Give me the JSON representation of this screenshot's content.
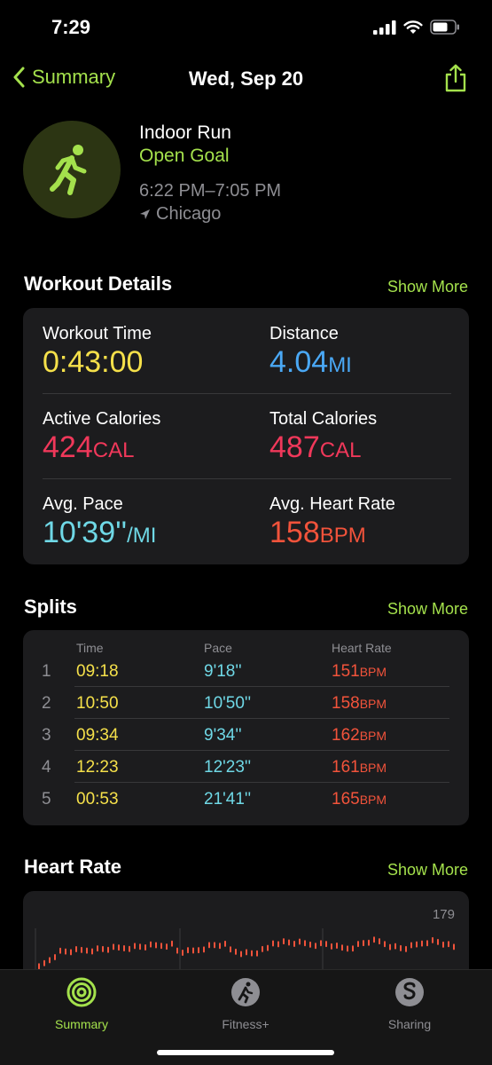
{
  "status_bar": {
    "time": "7:29"
  },
  "nav": {
    "back_label": "Summary",
    "title": "Wed, Sep 20"
  },
  "workout": {
    "type": "Indoor Run",
    "goal": "Open Goal",
    "time_range": "6:22 PM–7:05 PM",
    "location": "Chicago"
  },
  "details": {
    "title": "Workout Details",
    "show_more": "Show More",
    "workout_time": {
      "label": "Workout Time",
      "value": "0:43:00",
      "unit": ""
    },
    "distance": {
      "label": "Distance",
      "value": "4.04",
      "unit": "MI"
    },
    "active_calories": {
      "label": "Active Calories",
      "value": "424",
      "unit": "CAL"
    },
    "total_calories": {
      "label": "Total Calories",
      "value": "487",
      "unit": "CAL"
    },
    "avg_pace": {
      "label": "Avg. Pace",
      "value": "10'39''",
      "unit": "/MI"
    },
    "avg_heart_rate": {
      "label": "Avg. Heart Rate",
      "value": "158",
      "unit": "BPM"
    }
  },
  "splits": {
    "title": "Splits",
    "show_more": "Show More",
    "headers": {
      "time": "Time",
      "pace": "Pace",
      "hr": "Heart Rate"
    },
    "rows": [
      {
        "num": "1",
        "time": "09:18",
        "pace": "9'18''",
        "hr": "151",
        "unit": "BPM"
      },
      {
        "num": "2",
        "time": "10:50",
        "pace": "10'50''",
        "hr": "158",
        "unit": "BPM"
      },
      {
        "num": "3",
        "time": "09:34",
        "pace": "9'34''",
        "hr": "162",
        "unit": "BPM"
      },
      {
        "num": "4",
        "time": "12:23",
        "pace": "12'23''",
        "hr": "161",
        "unit": "BPM"
      },
      {
        "num": "5",
        "time": "00:53",
        "pace": "21'41''",
        "hr": "165",
        "unit": "BPM"
      }
    ]
  },
  "heart_rate": {
    "title": "Heart Rate",
    "show_more": "Show More",
    "max_label": "179"
  },
  "tabs": [
    {
      "label": "Summary",
      "icon": "activity-rings-icon",
      "active": true
    },
    {
      "label": "Fitness+",
      "icon": "fitness-plus-icon",
      "active": false
    },
    {
      "label": "Sharing",
      "icon": "sharing-icon",
      "active": false
    }
  ],
  "colors": {
    "accent": "#a4e14c",
    "time": "#f5e04a",
    "distance": "#4aa8f5",
    "calories": "#f0385a",
    "pace": "#6fd8e6",
    "heart": "#f2533b"
  }
}
